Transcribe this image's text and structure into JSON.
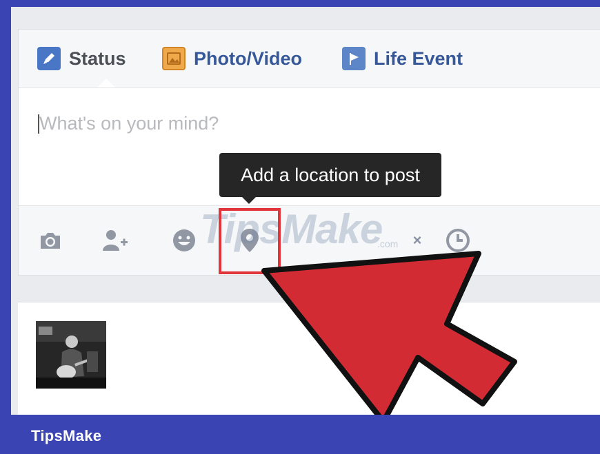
{
  "tabs": {
    "status": "Status",
    "photo_video": "Photo/Video",
    "life_event": "Life Event"
  },
  "composer": {
    "placeholder": "What's on your mind?"
  },
  "tooltip": {
    "text": "Add a location to post"
  },
  "actions": {
    "close_label": "×"
  },
  "icons": [
    "status-pencil-icon",
    "photo-icon",
    "life-event-flag-icon",
    "camera-icon",
    "tag-people-icon",
    "feeling-emoji-icon",
    "location-pin-icon",
    "close-icon",
    "clock-icon",
    "red-arrow-pointer"
  ],
  "watermark": {
    "text": "TipsMake",
    "suffix": ".com"
  },
  "footer": {
    "brand": "TipsMake"
  },
  "colors": {
    "frame": "#3a45b3",
    "link": "#365899",
    "tooltip_bg": "#262626",
    "highlight": "#e0353b"
  }
}
